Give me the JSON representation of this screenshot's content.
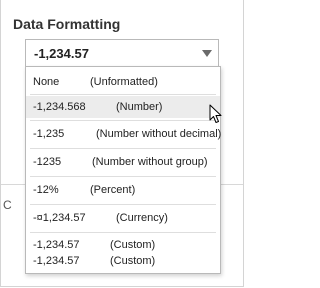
{
  "panel": {
    "title": "Data Formatting"
  },
  "select": {
    "value": "-1,234.57"
  },
  "side_fragment": "C",
  "options": [
    {
      "format": "None",
      "description": "(Unformatted)"
    },
    {
      "format": "-1,234.568",
      "description": "(Number)"
    },
    {
      "format": "-1,235",
      "description": "(Number without decimal)"
    },
    {
      "format": "-1235",
      "description": "(Number without group)"
    },
    {
      "format": "-12%",
      "description": "(Percent)"
    },
    {
      "format": "-¤1,234.57",
      "description": "(Currency)"
    },
    {
      "format": "-1,234.57",
      "description": "(Custom)"
    },
    {
      "format": "-1,234.57",
      "description": "(Custom)"
    }
  ],
  "hovered_option_index": 1
}
